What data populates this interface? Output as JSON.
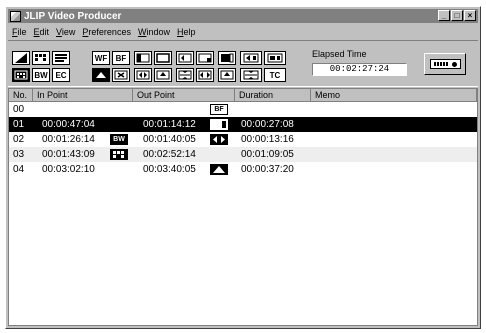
{
  "window": {
    "title": "JLIP Video Producer"
  },
  "window_controls": [
    "_",
    "□",
    "×"
  ],
  "menu": [
    "File",
    "Edit",
    "View",
    "Preferences",
    "Window",
    "Help"
  ],
  "toolbar": {
    "buttons_row1": [
      {
        "label": "",
        "icon": "wipe-icon"
      },
      {
        "label": "",
        "icon": "mosaic-icon"
      },
      {
        "label": "",
        "icon": "strobe-icon"
      },
      {
        "label": "WF",
        "icon": "white-fade-icon"
      },
      {
        "label": "BF",
        "icon": "black-fade-icon"
      },
      {
        "label": "",
        "icon": "wipe-left-icon"
      },
      {
        "label": "",
        "icon": "wipe-square-icon"
      },
      {
        "label": "",
        "icon": "wipe-door-icon"
      },
      {
        "label": "",
        "icon": "wipe-corner-icon"
      },
      {
        "label": "",
        "icon": "slide-icon"
      },
      {
        "label": "",
        "icon": "slide-in-icon"
      },
      {
        "label": "",
        "icon": "scroll-icon"
      }
    ],
    "buttons_row2": [
      {
        "label": "",
        "icon": "film-icon"
      },
      {
        "label": "BW",
        "icon": "black-white-icon"
      },
      {
        "label": "EC",
        "icon": "effect-clear-icon"
      },
      {
        "label": "",
        "icon": "sepia-icon"
      },
      {
        "label": "",
        "icon": "randomizer-icon"
      },
      {
        "label": "",
        "icon": "door-open-icon"
      },
      {
        "label": "",
        "icon": "scroll-up-icon"
      },
      {
        "label": "",
        "icon": "scroll-down-icon"
      },
      {
        "label": "",
        "icon": "wipe-horizontal-icon"
      },
      {
        "label": "",
        "icon": "slide-up-icon"
      },
      {
        "label": "",
        "icon": "slide-down-icon"
      },
      {
        "label": "TC",
        "icon": "timecode-icon"
      }
    ],
    "elapsed_label": "Elapsed Time",
    "elapsed_value": "00:02:27:24"
  },
  "table": {
    "columns": [
      "No.",
      "In Point",
      "Out Point",
      "Duration",
      "Memo"
    ],
    "rows": [
      {
        "no": "00",
        "in": "",
        "in_effect": "",
        "out": "",
        "out_effect": "BF",
        "duration": "",
        "memo": ""
      },
      {
        "no": "01",
        "in": "00:00:47:04",
        "in_effect": "",
        "out": "00:01:14:12",
        "out_effect": "slide",
        "duration": "00:00:27:08",
        "memo": ""
      },
      {
        "no": "02",
        "in": "00:01:26:14",
        "in_effect": "BW",
        "out": "00:01:40:05",
        "out_effect": "door",
        "duration": "00:00:13:16",
        "memo": ""
      },
      {
        "no": "03",
        "in": "00:01:43:09",
        "in_effect": "mosaic",
        "out": "00:02:52:14",
        "out_effect": "",
        "duration": "00:01:09:05",
        "memo": ""
      },
      {
        "no": "04",
        "in": "00:03:02:10",
        "in_effect": "",
        "out": "00:03:40:05",
        "out_effect": "sepia",
        "duration": "00:00:37:20",
        "memo": ""
      }
    ],
    "selected_row": "01"
  }
}
